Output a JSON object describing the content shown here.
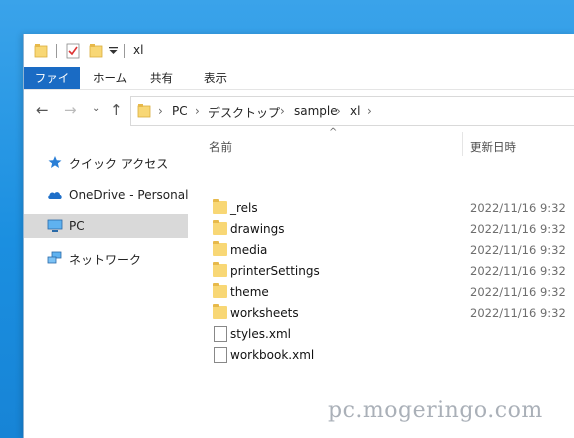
{
  "window": {
    "title": "xl"
  },
  "ribbon": {
    "tabs": [
      {
        "label": "ファイル"
      },
      {
        "label": "ホーム"
      },
      {
        "label": "共有"
      },
      {
        "label": "表示"
      }
    ]
  },
  "address": {
    "crumbs": [
      "PC",
      "デスクトップ",
      "sample",
      "xl"
    ]
  },
  "sidebar": {
    "items": [
      {
        "label": "クイック アクセス",
        "icon": "star-icon"
      },
      {
        "label": "OneDrive - Personal",
        "icon": "cloud-icon"
      },
      {
        "label": "PC",
        "icon": "monitor-icon"
      },
      {
        "label": "ネットワーク",
        "icon": "network-icon"
      }
    ]
  },
  "columns": {
    "name": "名前",
    "modified": "更新日時"
  },
  "files": [
    {
      "name": "_rels",
      "modified": "2022/11/16 9:32",
      "type": "folder"
    },
    {
      "name": "drawings",
      "modified": "2022/11/16 9:32",
      "type": "folder"
    },
    {
      "name": "media",
      "modified": "2022/11/16 9:32",
      "type": "folder"
    },
    {
      "name": "printerSettings",
      "modified": "2022/11/16 9:32",
      "type": "folder"
    },
    {
      "name": "theme",
      "modified": "2022/11/16 9:32",
      "type": "folder"
    },
    {
      "name": "worksheets",
      "modified": "2022/11/16 9:32",
      "type": "folder"
    },
    {
      "name": "styles.xml",
      "modified": "",
      "type": "file"
    },
    {
      "name": "workbook.xml",
      "modified": "",
      "type": "file"
    }
  ],
  "watermark": "pc.mogeringo.com",
  "colors": {
    "accent": "#1a6bc4",
    "folder": "#f8d775",
    "desktop": "#1b8fe0"
  }
}
